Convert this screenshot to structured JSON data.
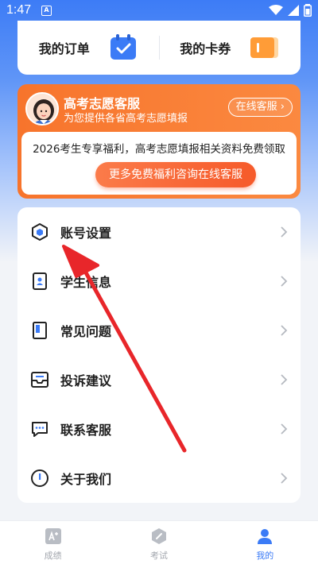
{
  "status_bar": {
    "time": "1:47",
    "notification_badge": "A"
  },
  "orders": [
    {
      "label": "我的订单",
      "icon": "calendar-check-icon"
    },
    {
      "label": "我的卡券",
      "icon": "coupon-card-icon"
    }
  ],
  "promo": {
    "title": "高考志愿客服",
    "subtitle": "为您提供各省高考志愿填报",
    "online_button": "在线客服 ›",
    "text": "2026考生专享福利，高考志愿填报相关资料免费领取",
    "cta": "更多免费福利咨询在线客服"
  },
  "menu": [
    {
      "label": "账号设置",
      "icon": "hexagon-settings-icon"
    },
    {
      "label": "学生信息",
      "icon": "student-id-icon"
    },
    {
      "label": "常见问题",
      "icon": "book-icon"
    },
    {
      "label": "投诉建议",
      "icon": "inbox-icon"
    },
    {
      "label": "联系客服",
      "icon": "chat-icon"
    },
    {
      "label": "关于我们",
      "icon": "info-icon"
    }
  ],
  "tabs": [
    {
      "label": "成绩",
      "icon": "score-icon",
      "active": false
    },
    {
      "label": "考试",
      "icon": "exam-icon",
      "active": false
    },
    {
      "label": "我的",
      "icon": "person-icon",
      "active": true
    }
  ],
  "colors": {
    "primary": "#3b7bf6",
    "promo_orange": "#f7742c",
    "annotation_red": "#e8262a"
  }
}
